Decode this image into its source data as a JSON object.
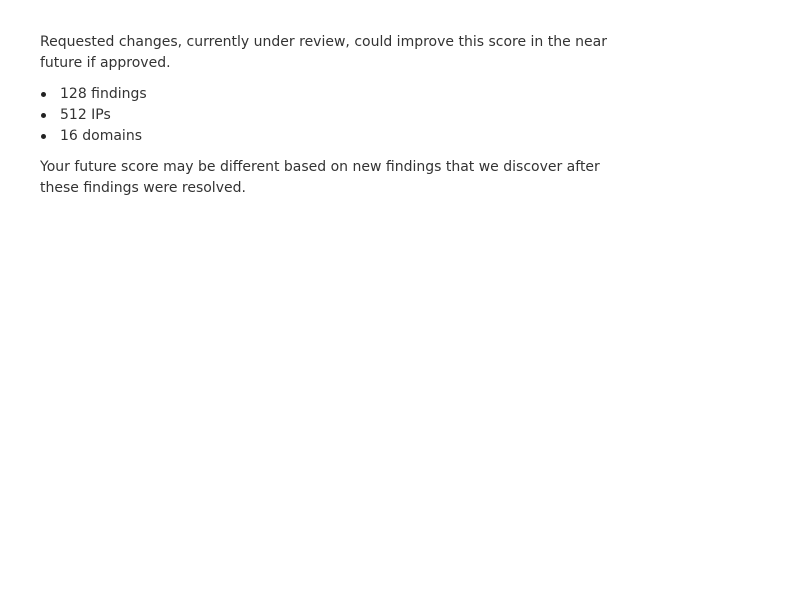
{
  "intro_text": "Requested changes, currently under review, could improve this score in the near future if approved.",
  "changes": [
    {
      "label": "128 findings"
    },
    {
      "label": "512 IPs"
    },
    {
      "label": "16 domains"
    }
  ],
  "disclaimer_text": "Your future score may be different based on new findings that we discover after these findings were resolved.",
  "colors": {
    "text": "#333333",
    "bullet": "#222222",
    "background": "#ffffff"
  }
}
